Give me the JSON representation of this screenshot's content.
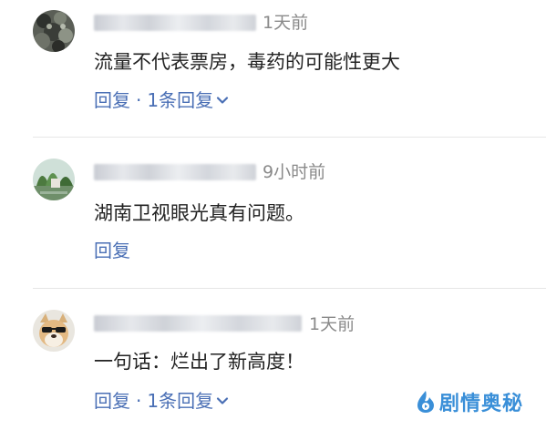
{
  "comments": [
    {
      "time": "1天前",
      "text": "流量不代表票房，毒药的可能性更大",
      "reply_label": "回复",
      "separator": "·",
      "replies_label": "1条回复"
    },
    {
      "time": "9小时前",
      "text": "湖南卫视眼光真有问题。",
      "reply_label": "回复"
    },
    {
      "time": "1天前",
      "text": "一句话：烂出了新高度！",
      "reply_label": "回复",
      "separator": "·",
      "replies_label": "1条回复"
    }
  ],
  "watermark": {
    "text": "剧情奥秘"
  },
  "colors": {
    "link": "#4a6fb5",
    "time": "#8a8a8a",
    "text": "#222222",
    "divider": "#e6e6e6",
    "watermark": "#3a8fd8"
  },
  "icons": {
    "expand": "chevron-down-icon",
    "logo": "flame-logo-icon"
  }
}
